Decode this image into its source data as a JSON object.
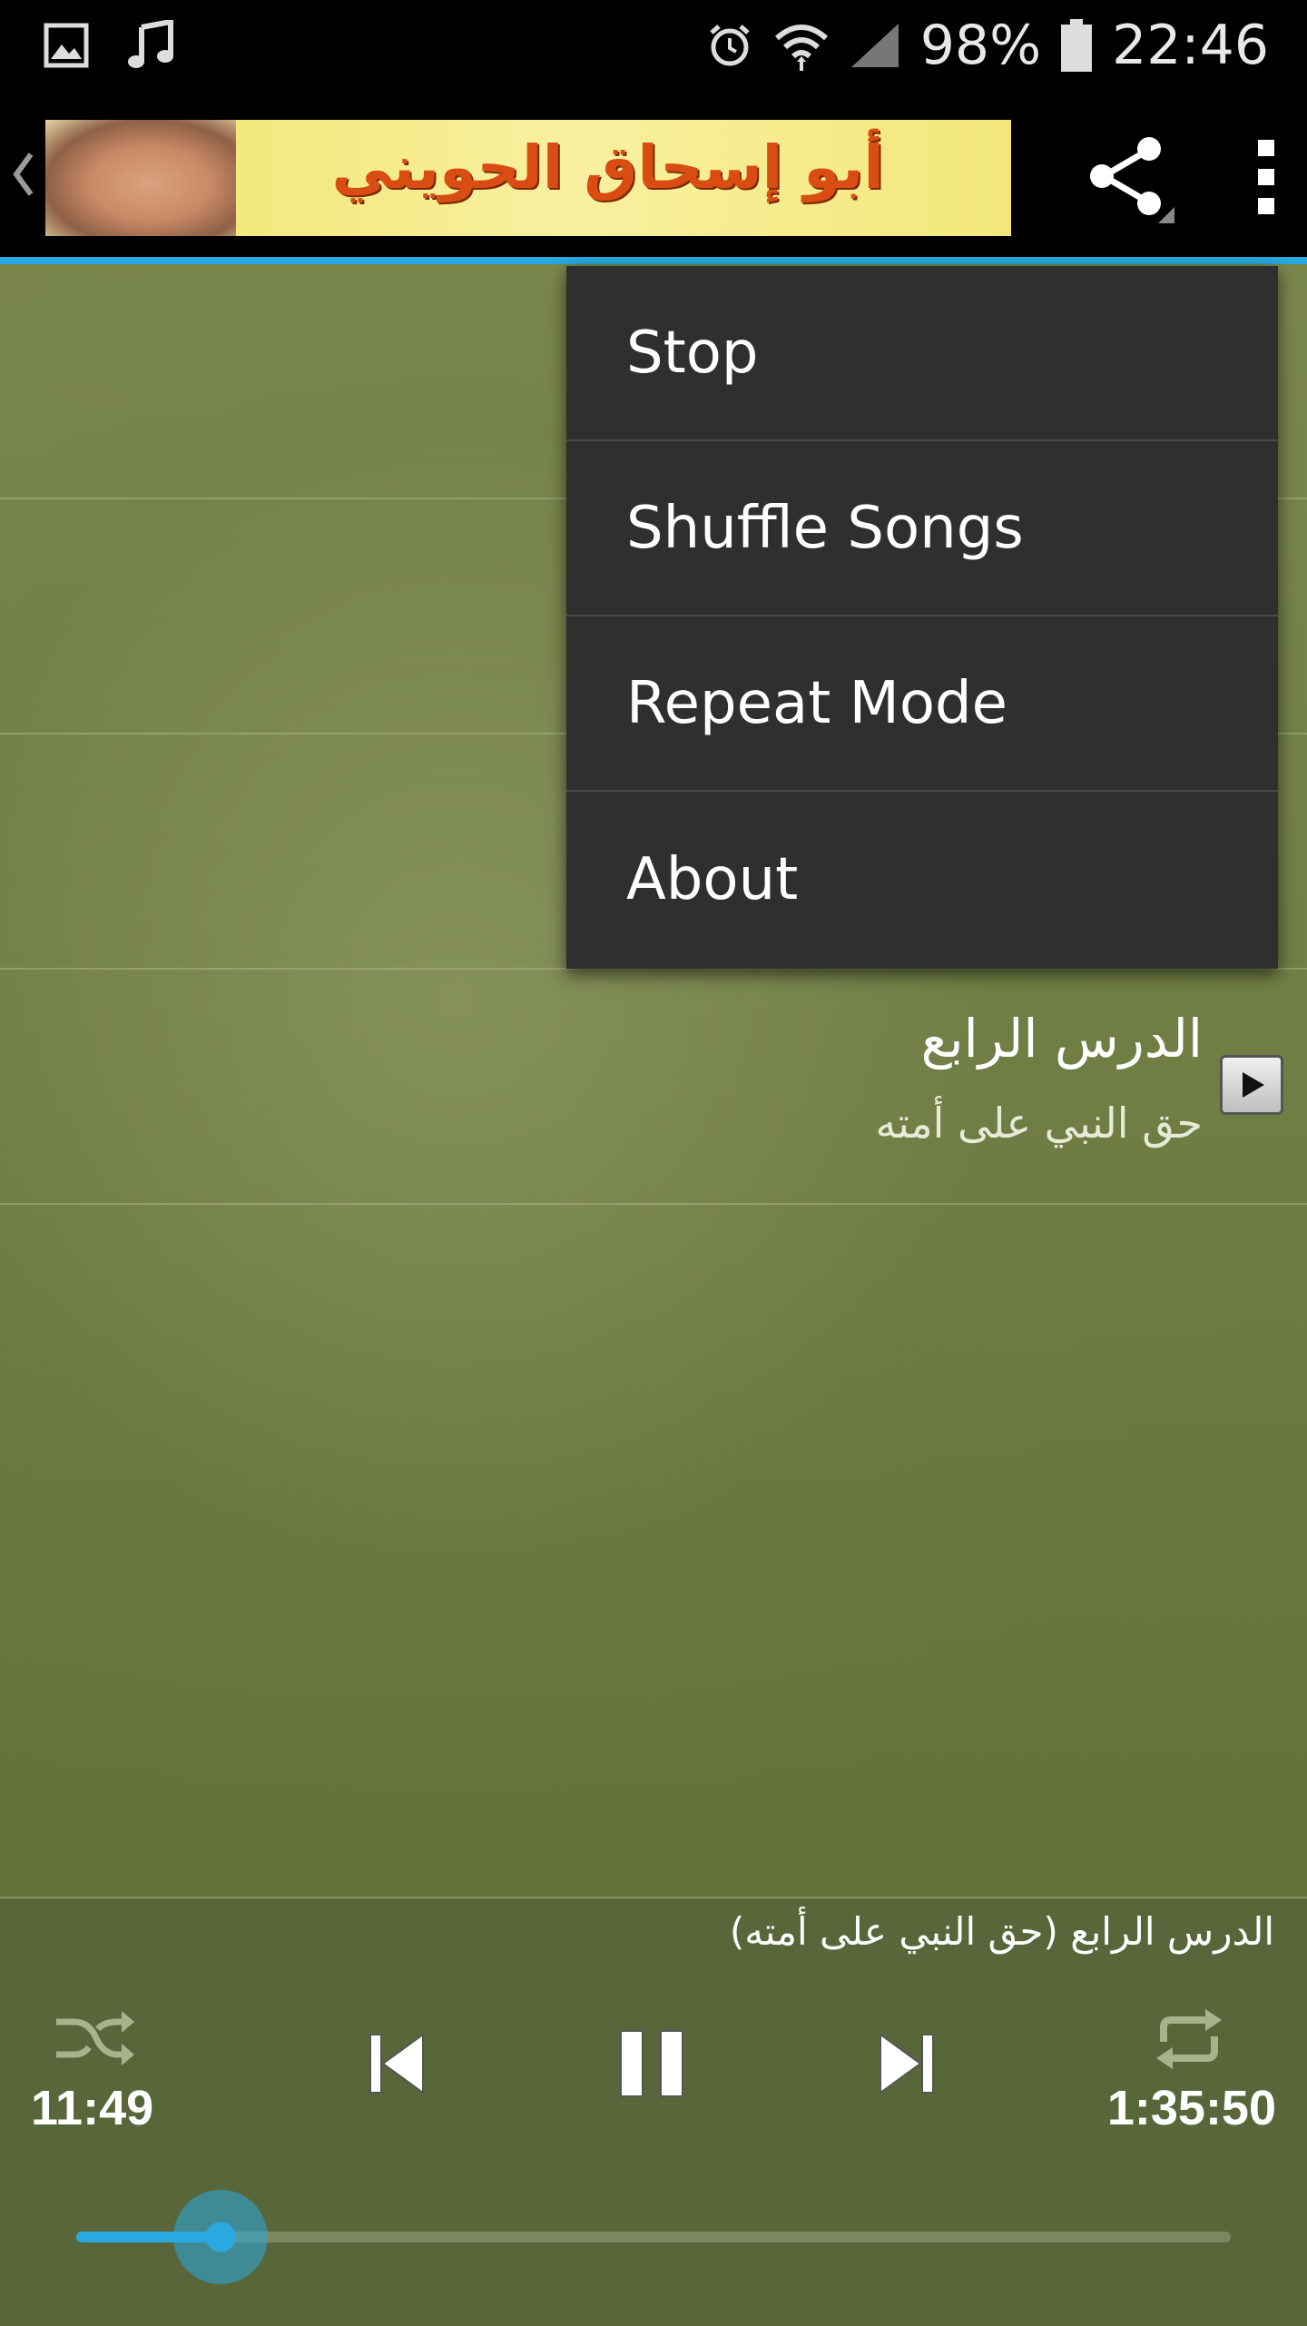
{
  "status_bar": {
    "battery": "98%",
    "time": "22:46",
    "icons": [
      "gallery-icon",
      "music-note-icon",
      "alarm-icon",
      "wifi-icon",
      "signal-icon",
      "battery-icon"
    ]
  },
  "action_bar": {
    "banner_title": "أبو إسحاق الحويني",
    "icons": [
      "back-chevron-icon",
      "share-icon",
      "overflow-menu-icon"
    ],
    "accent_color": "#29a9e0"
  },
  "menu": {
    "items": [
      "Stop",
      "Shuffle Songs",
      "Repeat Mode",
      "About"
    ]
  },
  "playlist": {
    "visible_item": {
      "title": "الدرس الرابع",
      "subtitle": "حق النبي على أمته"
    }
  },
  "player": {
    "now_playing": "الدرس الرابع (حق النبي على أمته)",
    "elapsed": "11:49",
    "duration": "1:35:50",
    "progress": 0.125,
    "controls": [
      "shuffle-icon",
      "previous-icon",
      "pause-icon",
      "next-icon",
      "repeat-icon"
    ]
  }
}
